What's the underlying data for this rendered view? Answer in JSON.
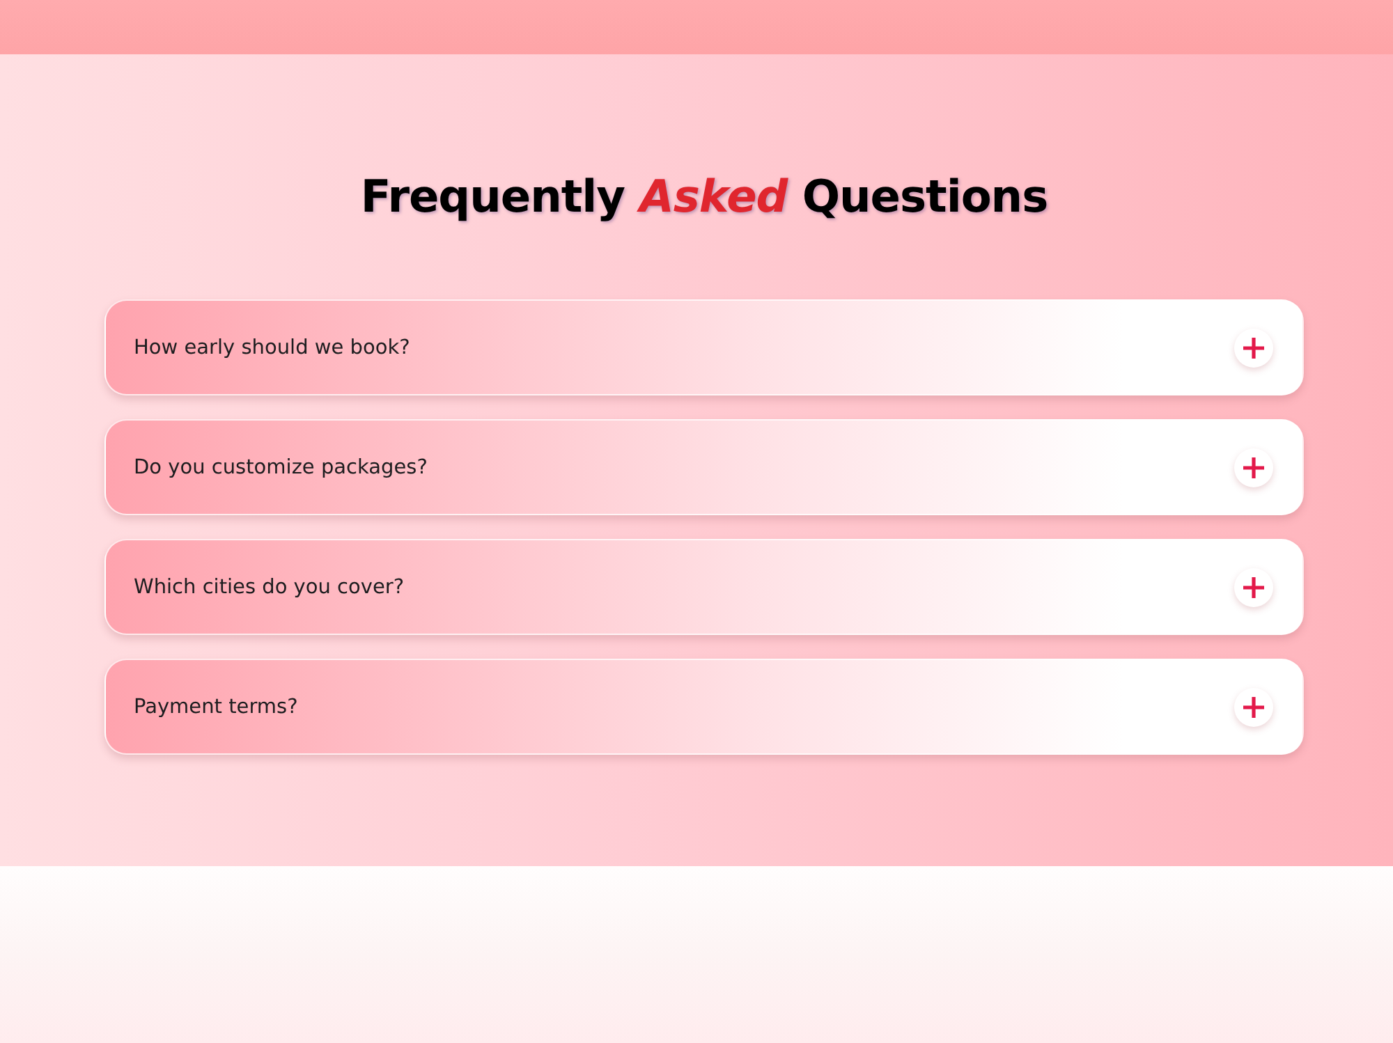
{
  "title": "Frequently *Asked* Questions",
  "faq_items": [
    {
      "question": "How early should we book?",
      "expanded": false
    },
    {
      "question": "Do you customize packages?",
      "expanded": false
    },
    {
      "question": "Which cities do you cover?",
      "expanded": false
    },
    {
      "question": "Payment terms?",
      "expanded": false
    }
  ]
}
